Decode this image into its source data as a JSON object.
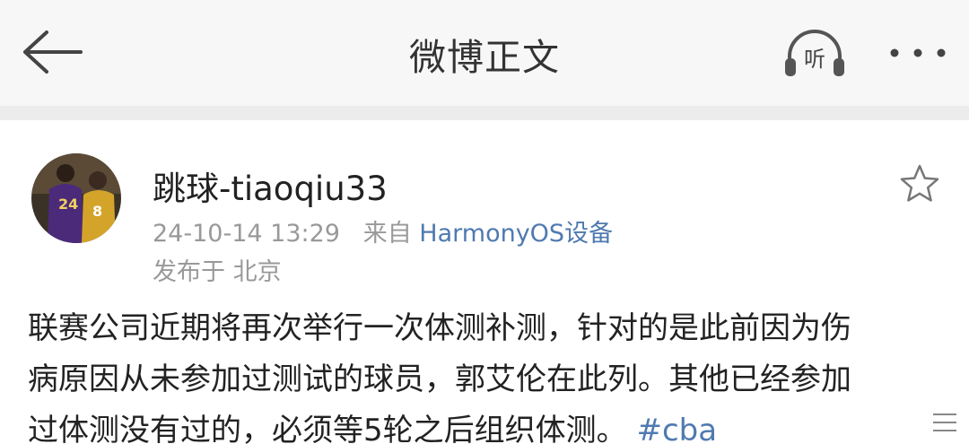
{
  "header": {
    "title": "微博正文",
    "back_icon": "arrow-left-icon",
    "listen_label": "听",
    "more_icon": "more-dots-icon"
  },
  "post": {
    "author": "跳球-tiaoqiu33",
    "timestamp": "24-10-14 13:29",
    "source_prefix": "来自",
    "source_name": "HarmonyOS设备",
    "location": "发布于 北京",
    "lines": [
      "联赛公司近期将再次举行一次体测补测，针对的是此前因为伤",
      "病原因从未参加过测试的球员，郭艾伦在此列。其他已经参加",
      "过体测没有过的，必须等5轮之后组织体测。"
    ],
    "hashtag": "#cba",
    "favorite_icon": "star-outline-icon"
  },
  "colors": {
    "header_bg": "#f7f7f7",
    "link": "#4f7ab0",
    "meta": "#999999"
  }
}
